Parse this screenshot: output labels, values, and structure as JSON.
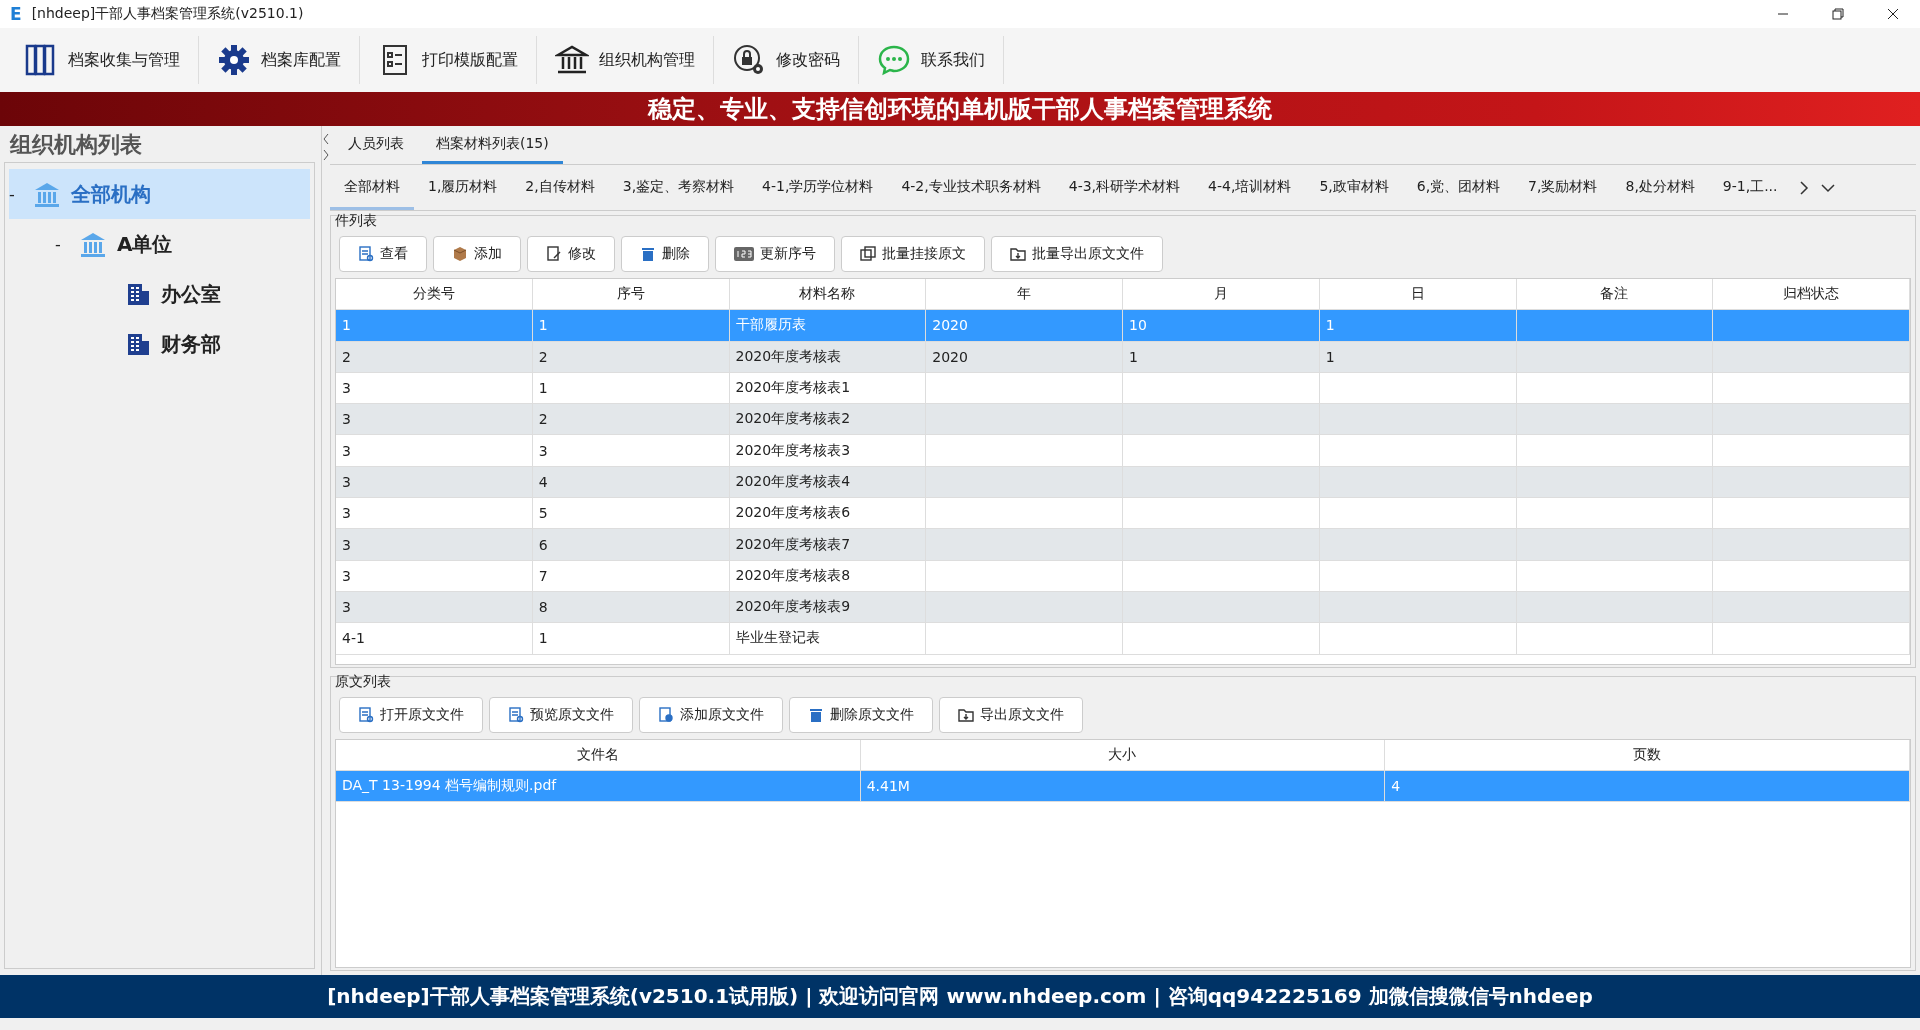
{
  "window": {
    "logo": "E",
    "title": "[nhdeep]干部人事档案管理系统(v2510.1)"
  },
  "toolbar": [
    {
      "label": "档案收集与管理",
      "kind": "shelves"
    },
    {
      "label": "档案库配置",
      "kind": "gear"
    },
    {
      "label": "打印模版配置",
      "kind": "form"
    },
    {
      "label": "组织机构管理",
      "kind": "building"
    },
    {
      "label": "修改密码",
      "kind": "lock"
    },
    {
      "label": "联系我们",
      "kind": "chat"
    }
  ],
  "banner": "稳定、专业、支持信创环境的单机版干部人事档案管理系统",
  "sidebar": {
    "title": "组织机构列表",
    "tree": [
      {
        "label": "全部机构",
        "toggle": "-",
        "selected": true,
        "kind": "root",
        "children": [
          {
            "label": "A单位",
            "toggle": "-",
            "selected": false,
            "kind": "unit",
            "children": [
              {
                "label": "办公室",
                "selected": false,
                "kind": "dept"
              },
              {
                "label": "财务部",
                "selected": false,
                "kind": "dept"
              }
            ]
          }
        ]
      }
    ]
  },
  "tabs": [
    {
      "label": "人员列表",
      "selected": false
    },
    {
      "label": "档案材料列表(15)",
      "selected": true
    }
  ],
  "category_tabs": [
    {
      "label": "全部材料",
      "selected": true
    },
    {
      "label": "1,履历材料",
      "selected": false
    },
    {
      "label": "2,自传材料",
      "selected": false
    },
    {
      "label": "3,鉴定、考察材料",
      "selected": false
    },
    {
      "label": "4-1,学历学位材料",
      "selected": false
    },
    {
      "label": "4-2,专业技术职务材料",
      "selected": false
    },
    {
      "label": "4-3,科研学术材料",
      "selected": false
    },
    {
      "label": "4-4,培训材料",
      "selected": false
    },
    {
      "label": "5,政审材料",
      "selected": false
    },
    {
      "label": "6,党、团材料",
      "selected": false
    },
    {
      "label": "7,奖励材料",
      "selected": false
    },
    {
      "label": "8,处分材料",
      "selected": false
    },
    {
      "label": "9-1,工...",
      "selected": false
    }
  ],
  "items_panel": {
    "title": "件列表",
    "buttons": [
      {
        "label": "查看",
        "kind": "view"
      },
      {
        "label": "添加",
        "kind": "box"
      },
      {
        "label": "修改",
        "kind": "edit"
      },
      {
        "label": "删除",
        "kind": "trash"
      },
      {
        "label": "更新序号",
        "kind": "number"
      },
      {
        "label": "批量挂接原文",
        "kind": "copy"
      },
      {
        "label": "批量导出原文文件",
        "kind": "export"
      }
    ],
    "columns": [
      "分类号",
      "序号",
      "材料名称",
      "年",
      "月",
      "日",
      "备注",
      "归档状态"
    ],
    "rows": [
      {
        "selected": true,
        "cells": [
          "1",
          "1",
          "干部履历表",
          "2020",
          "10",
          "1",
          "",
          ""
        ]
      },
      {
        "selected": false,
        "cells": [
          "2",
          "2",
          "2020年度考核表",
          "2020",
          "1",
          "1",
          "",
          ""
        ]
      },
      {
        "selected": false,
        "cells": [
          "3",
          "1",
          "2020年度考核表1",
          "",
          "",
          "",
          "",
          ""
        ]
      },
      {
        "selected": false,
        "cells": [
          "3",
          "2",
          "2020年度考核表2",
          "",
          "",
          "",
          "",
          ""
        ]
      },
      {
        "selected": false,
        "cells": [
          "3",
          "3",
          "2020年度考核表3",
          "",
          "",
          "",
          "",
          ""
        ]
      },
      {
        "selected": false,
        "cells": [
          "3",
          "4",
          "2020年度考核表4",
          "",
          "",
          "",
          "",
          ""
        ]
      },
      {
        "selected": false,
        "cells": [
          "3",
          "5",
          "2020年度考核表6",
          "",
          "",
          "",
          "",
          ""
        ]
      },
      {
        "selected": false,
        "cells": [
          "3",
          "6",
          "2020年度考核表7",
          "",
          "",
          "",
          "",
          ""
        ]
      },
      {
        "selected": false,
        "cells": [
          "3",
          "7",
          "2020年度考核表8",
          "",
          "",
          "",
          "",
          ""
        ]
      },
      {
        "selected": false,
        "cells": [
          "3",
          "8",
          "2020年度考核表9",
          "",
          "",
          "",
          "",
          ""
        ]
      },
      {
        "selected": false,
        "cells": [
          "4-1",
          "1",
          "毕业生登记表",
          "",
          "",
          "",
          "",
          ""
        ]
      }
    ]
  },
  "files_panel": {
    "title": "原文列表",
    "buttons": [
      {
        "label": "打开原文文件",
        "kind": "view"
      },
      {
        "label": "预览原文文件",
        "kind": "view"
      },
      {
        "label": "添加原文文件",
        "kind": "add"
      },
      {
        "label": "删除原文文件",
        "kind": "trash"
      },
      {
        "label": "导出原文文件",
        "kind": "export"
      }
    ],
    "columns": [
      "文件名",
      "大小",
      "页数"
    ],
    "rows": [
      {
        "selected": true,
        "cells": [
          "DA_T 13-1994 档号编制规则.pdf",
          "4.41M",
          "4"
        ]
      }
    ]
  },
  "status_bar": "[nhdeep]干部人事档案管理系统(v2510.1试用版) | 欢迎访问官网 www.nhdeep.com | 咨询qq942225169 加微信搜微信号nhdeep"
}
